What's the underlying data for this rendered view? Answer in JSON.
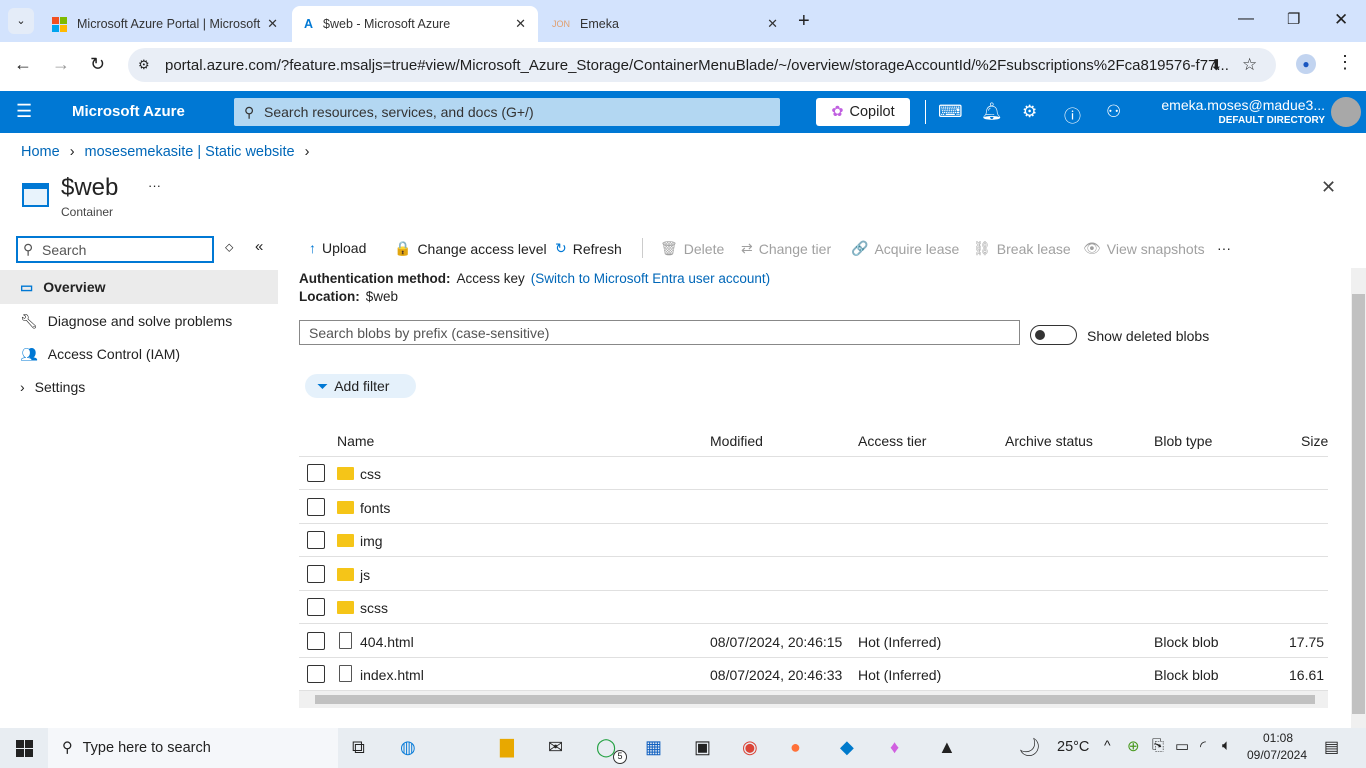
{
  "browser": {
    "tabs": [
      {
        "title": "Microsoft Azure Portal | Microsoft"
      },
      {
        "title": "$web - Microsoft Azure"
      },
      {
        "title": "Emeka"
      }
    ],
    "url": "portal.azure.com/?feature.msaljs=true#view/Microsoft_Azure_Storage/ContainerMenuBlade/~/overview/storageAccountId/%2Fsubscriptions%2Fca819576-f77..."
  },
  "azure": {
    "brand": "Microsoft Azure",
    "search_placeholder": "Search resources, services, and docs (G+/)",
    "copilot": "Copilot",
    "user": "emeka.moses@madue3...",
    "directory": "DEFAULT DIRECTORY"
  },
  "breadcrumb": [
    "Home",
    "mosesemekasite | Static website"
  ],
  "page": {
    "title": "$web",
    "subtitle": "Container",
    "more": "···"
  },
  "sidebar": {
    "search_placeholder": "Search",
    "items": [
      {
        "label": "Overview"
      },
      {
        "label": "Diagnose and solve problems"
      },
      {
        "label": "Access Control (IAM)"
      },
      {
        "label": "Settings"
      }
    ]
  },
  "toolbar": {
    "items": [
      {
        "label": "Upload",
        "icon": "↑"
      },
      {
        "label": "Change access level",
        "icon": "🔒"
      },
      {
        "label": "Refresh",
        "icon": "↻"
      },
      {
        "label": "Delete",
        "icon": "🗑"
      },
      {
        "label": "Change tier",
        "icon": "⇄"
      },
      {
        "label": "Acquire lease",
        "icon": "🔗"
      },
      {
        "label": "Break lease",
        "icon": "⛓"
      },
      {
        "label": "View snapshots",
        "icon": "👁"
      }
    ],
    "more": "···"
  },
  "auth": {
    "label": "Authentication method:",
    "value": "Access key",
    "link": "(Switch to Microsoft Entra user account)",
    "loc_label": "Location:",
    "loc_value": "$web"
  },
  "blob_search_placeholder": "Search blobs by prefix (case-sensitive)",
  "show_deleted": {
    "label": "Show deleted blobs",
    "on": false
  },
  "add_filter": "Add filter",
  "table": {
    "columns": [
      "Name",
      "Modified",
      "Access tier",
      "Archive status",
      "Blob type",
      "Size"
    ],
    "rows": [
      {
        "name": "css",
        "type": "folder",
        "modified": "",
        "tier": "",
        "archive": "",
        "blobtype": "",
        "size": ""
      },
      {
        "name": "fonts",
        "type": "folder",
        "modified": "",
        "tier": "",
        "archive": "",
        "blobtype": "",
        "size": ""
      },
      {
        "name": "img",
        "type": "folder",
        "modified": "",
        "tier": "",
        "archive": "",
        "blobtype": "",
        "size": ""
      },
      {
        "name": "js",
        "type": "folder",
        "modified": "",
        "tier": "",
        "archive": "",
        "blobtype": "",
        "size": ""
      },
      {
        "name": "scss",
        "type": "folder",
        "modified": "",
        "tier": "",
        "archive": "",
        "blobtype": "",
        "size": ""
      },
      {
        "name": "404.html",
        "type": "file",
        "modified": "08/07/2024, 20:46:15",
        "tier": "Hot (Inferred)",
        "archive": "",
        "blobtype": "Block blob",
        "size": "17.75"
      },
      {
        "name": "index.html",
        "type": "file",
        "modified": "08/07/2024, 20:46:33",
        "tier": "Hot (Inferred)",
        "archive": "",
        "blobtype": "Block blob",
        "size": "16.61"
      }
    ]
  },
  "taskbar": {
    "search": "Type here to search",
    "temp": "25°C",
    "time": "01:08",
    "date": "09/07/2024",
    "badge": "5"
  }
}
